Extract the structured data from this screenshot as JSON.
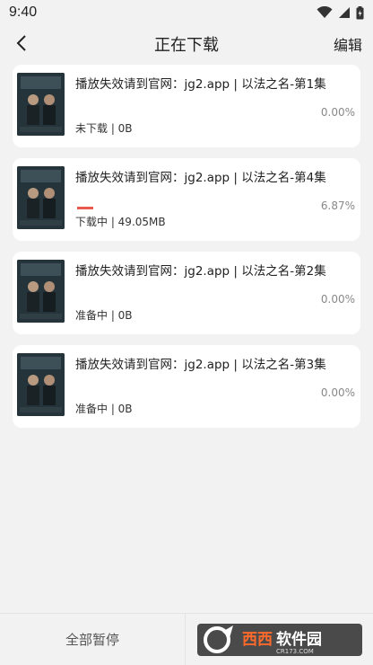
{
  "status_bar": {
    "time": "9:40"
  },
  "nav": {
    "title": "正在下载",
    "edit_label": "编辑"
  },
  "downloads": [
    {
      "title": "播放失效请到官网：jg2.app | 以法之名-第1集",
      "percent": "0.00%",
      "status": "未下载 | 0B",
      "progress": 0
    },
    {
      "title": "播放失效请到官网：jg2.app | 以法之名-第4集",
      "percent": "6.87%",
      "status": "下载中 | 49.05MB",
      "progress": 0.0687
    },
    {
      "title": "播放失效请到官网：jg2.app | 以法之名-第2集",
      "percent": "0.00%",
      "status": "准备中 | 0B",
      "progress": 0
    },
    {
      "title": "播放失效请到官网：jg2.app | 以法之名-第3集",
      "percent": "0.00%",
      "status": "准备中 | 0B",
      "progress": 0
    }
  ],
  "bottom": {
    "pause_all_label": "全部暂停"
  },
  "watermark": {
    "text": "西西软件园",
    "url_text": "CR173.COM"
  },
  "colors": {
    "accent": "#e85a4f",
    "background": "#f2f2f2",
    "card": "#ffffff"
  },
  "icons": {
    "back": "chevron-left-icon",
    "wifi": "wifi-icon",
    "signal": "signal-icon",
    "battery": "battery-icon"
  }
}
